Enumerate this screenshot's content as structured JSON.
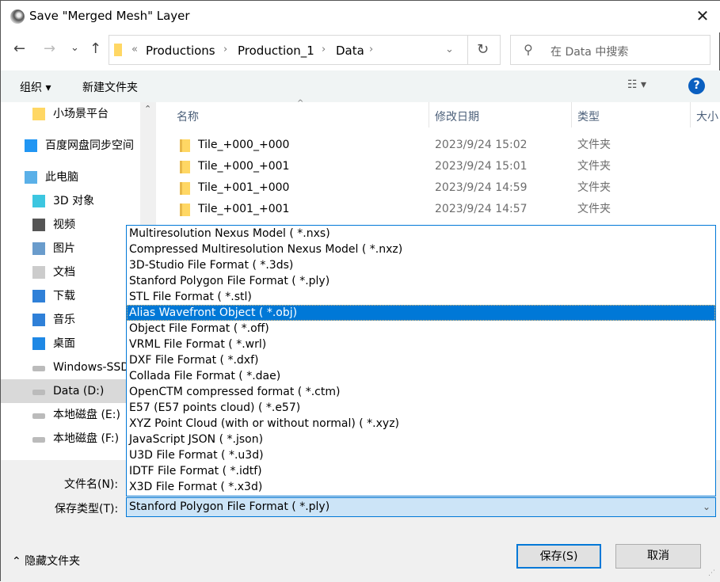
{
  "window": {
    "title": "Save \"Merged Mesh\" Layer",
    "close": "✕"
  },
  "nav": {
    "back": "←",
    "forward": "→",
    "recent": "⌄",
    "up": "↑"
  },
  "address": {
    "overflow": "«",
    "crumbs": [
      "Productions",
      "Production_1",
      "Data"
    ],
    "refresh": "↻"
  },
  "search": {
    "placeholder": "在 Data 中搜索"
  },
  "toolbar": {
    "organize": "组织 ▾",
    "new_folder": "新建文件夹",
    "view": "☷ ▾",
    "help": "?"
  },
  "sidebar": {
    "items": [
      {
        "label": "小场景平台",
        "icon": "folder-icon"
      },
      {
        "label": "百度网盘同步空间",
        "icon": "baidu-netdisk-icon"
      },
      {
        "label": "此电脑",
        "icon": "computer-icon"
      },
      {
        "label": "3D 对象",
        "icon": "3d-objects-icon"
      },
      {
        "label": "视频",
        "icon": "video-icon"
      },
      {
        "label": "图片",
        "icon": "pictures-icon"
      },
      {
        "label": "文档",
        "icon": "documents-icon"
      },
      {
        "label": "下载",
        "icon": "download-icon"
      },
      {
        "label": "音乐",
        "icon": "music-icon"
      },
      {
        "label": "桌面",
        "icon": "desktop-icon"
      },
      {
        "label": "Windows-SSD",
        "icon": "drive-icon"
      },
      {
        "label": "Data (D:)",
        "icon": "drive-icon"
      },
      {
        "label": "本地磁盘 (E:)",
        "icon": "drive-icon"
      },
      {
        "label": "本地磁盘 (F:)",
        "icon": "drive-icon"
      }
    ]
  },
  "columns": {
    "name": "名称",
    "date": "修改日期",
    "type": "类型",
    "size": "大小"
  },
  "files": [
    {
      "name": "Tile_+000_+000",
      "date": "2023/9/24 15:02",
      "type": "文件夹"
    },
    {
      "name": "Tile_+000_+001",
      "date": "2023/9/24 15:01",
      "type": "文件夹"
    },
    {
      "name": "Tile_+001_+000",
      "date": "2023/9/24 14:59",
      "type": "文件夹"
    },
    {
      "name": "Tile_+001_+001",
      "date": "2023/9/24 14:57",
      "type": "文件夹"
    }
  ],
  "dropdown": {
    "options": [
      "Multiresolution Nexus Model ( *.nxs)",
      "Compressed Multiresolution Nexus Model ( *.nxz)",
      "3D-Studio File Format ( *.3ds)",
      "Stanford Polygon File Format ( *.ply)",
      "STL File Format ( *.stl)",
      "Alias Wavefront Object ( *.obj)",
      "Object File Format ( *.off)",
      "VRML File Format ( *.wrl)",
      "DXF File Format ( *.dxf)",
      "Collada File Format ( *.dae)",
      "OpenCTM compressed format ( *.ctm)",
      "E57 (E57 points cloud) ( *.e57)",
      "XYZ Point Cloud (with or without normal) ( *.xyz)",
      "JavaScript JSON ( *.json)",
      "U3D File Format ( *.u3d)",
      "IDTF File Format ( *.idtf)",
      "X3D File Format ( *.x3d)"
    ],
    "highlighted": 5
  },
  "form": {
    "filename_label": "文件名(N):",
    "type_label": "保存类型(T):",
    "type_value": "Stanford Polygon File Format ( *.ply)"
  },
  "footer": {
    "hide_folders": "⌃ 隐藏文件夹",
    "save": "保存(S)",
    "cancel": "取消"
  }
}
